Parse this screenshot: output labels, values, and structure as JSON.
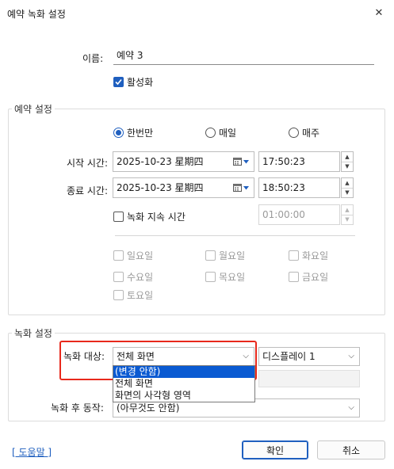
{
  "window": {
    "title": "예약 녹화 설정",
    "close_glyph": "✕"
  },
  "name": {
    "label": "이름:",
    "value": "예약 3"
  },
  "enable": {
    "label": "활성화",
    "checked": true
  },
  "schedule": {
    "group_label": "예약 설정",
    "radios": [
      {
        "label": "한번만",
        "checked": true
      },
      {
        "label": "매일",
        "checked": false
      },
      {
        "label": "매주",
        "checked": false
      }
    ],
    "start_label": "시작 시간:",
    "start_date": "2025-10-23 星期四",
    "start_time": "17:50:23",
    "end_label": "종료 시간:",
    "end_date": "2025-10-23 星期四",
    "end_time": "18:50:23",
    "duration_label": "녹화 지속 시간",
    "duration_value": "01:00:00",
    "weekdays": [
      "일요일",
      "월요일",
      "화요일",
      "수요일",
      "목요일",
      "금요일",
      "토요일"
    ]
  },
  "recording": {
    "group_label": "녹화 설정",
    "target_label": "녹화 대상:",
    "target_value": "전체 화면",
    "display_value": "디스플레이 1",
    "after_label": "녹화 후 동작:",
    "after_value": "(아무것도 안함)",
    "dropdown_options": [
      "(변경 안함)",
      "전체 화면",
      "화면의 사각형 영역"
    ],
    "selected_option_index": 0
  },
  "footer": {
    "help_label": "[ 도움말 ]",
    "ok_label": "확인",
    "cancel_label": "취소"
  },
  "colors": {
    "accent": "#1f5fbf",
    "highlight": "#e8291c",
    "selection": "#0a5ad2"
  }
}
